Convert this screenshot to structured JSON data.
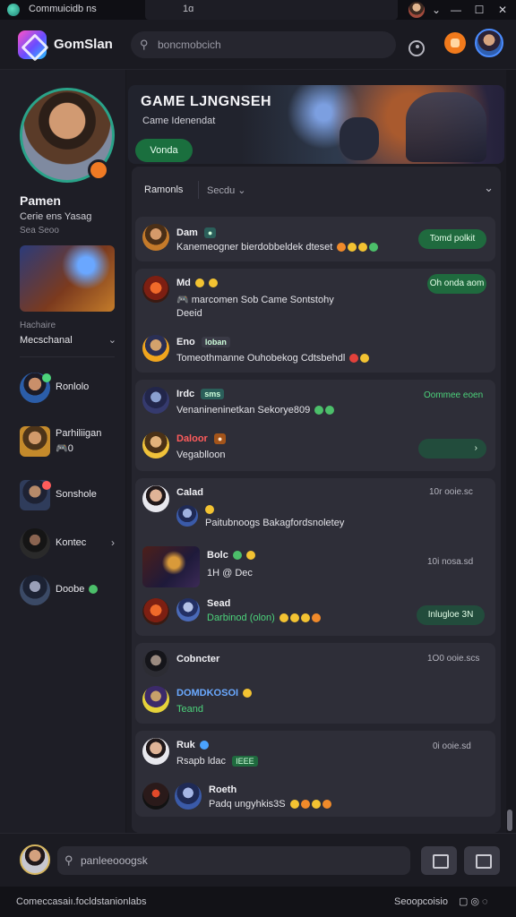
{
  "titlebar": {
    "app_title": "Commuicidb ns",
    "tab_text": "1ɑ",
    "controls": [
      "⌄",
      "—",
      "☐",
      "✕"
    ]
  },
  "topnav": {
    "brand": "GomSlan",
    "search_placeholder": "boncmobcich"
  },
  "sidebar": {
    "profile_name": "Pamen",
    "profile_subtitle": "Cerie ens Yasag",
    "profile_meta": "Sea Seoo",
    "section_label": "Hachaire",
    "dropdown_value": "Mecschanal",
    "friends": [
      {
        "name": "Ronlolo",
        "color": "#2b5da8",
        "dot": "#4cd37b"
      },
      {
        "name": "Parhiliigan",
        "name2": "🎮0",
        "color": "#c48a2b",
        "dot": ""
      },
      {
        "name": "Sonshole",
        "color": "#2f3c5b",
        "dot": "#ff5c5c"
      },
      {
        "name": "Kontec",
        "color": "#2a2a2a",
        "dot": ""
      },
      {
        "name": "Doobe",
        "color": "#3b4a66",
        "dot": "#4cd37b"
      }
    ]
  },
  "hero": {
    "title": "GAME LJNGNSEH",
    "subtitle": "Came Idenendat",
    "button": "Vonda"
  },
  "filters": {
    "primary": "Ramonls",
    "secondary": "Secdu"
  },
  "cards": [
    {
      "name": "Dam",
      "text": "Kanemeogner bierdobbeldek dteset",
      "button": "Tomd polkit"
    },
    {
      "name": "Md",
      "text": "🎮 marcomen Sob Came Sontstohy",
      "text2": "Deeid",
      "button": "Oh onda aom",
      "name_b": "Eno",
      "chip_b": "loban",
      "text_b": "Tomeothmanne Ouhobekog Cdtsbehdl"
    },
    {
      "name": "Irdc",
      "chip": "sms",
      "text": "Venanineninetkan Sekorye809",
      "time": "Oommee eoen",
      "name_b": "Daloor",
      "text_b": "Vegablloon"
    },
    {
      "name": "Calad",
      "time": "10r ooie.sc",
      "text": "Paitubnoogs Bakagfordsnoletey",
      "name_b": "Bolc",
      "text_b": "1H @ Dec",
      "time_b": "10i nosa.sd",
      "name_c": "Sead",
      "text_c": "Darbinod (olon)",
      "button_c": "Inlugloe 3N"
    },
    {
      "name": "Cobncter",
      "time": "1O0 ooie.scs",
      "name_b": "DOMDKOSOI",
      "text_b": "Teand"
    },
    {
      "name": "Ruk",
      "time": "0i ooie.sd",
      "text": "Rsapb ldac",
      "chip": "IEEE",
      "name_b": "Roeth",
      "text_b": "Padq ungyhkis3S"
    }
  ],
  "bottombar": {
    "compose_placeholder": "panleeooogsk"
  },
  "statusbar": {
    "left": "Comeccasaiı.focldstanionlabs",
    "right": "Seoopcoisio",
    "icons": "▢◎◌"
  },
  "colors": {
    "accent_green": "#1f6a3e",
    "background": "#17171d",
    "card": "#2e2e38"
  }
}
